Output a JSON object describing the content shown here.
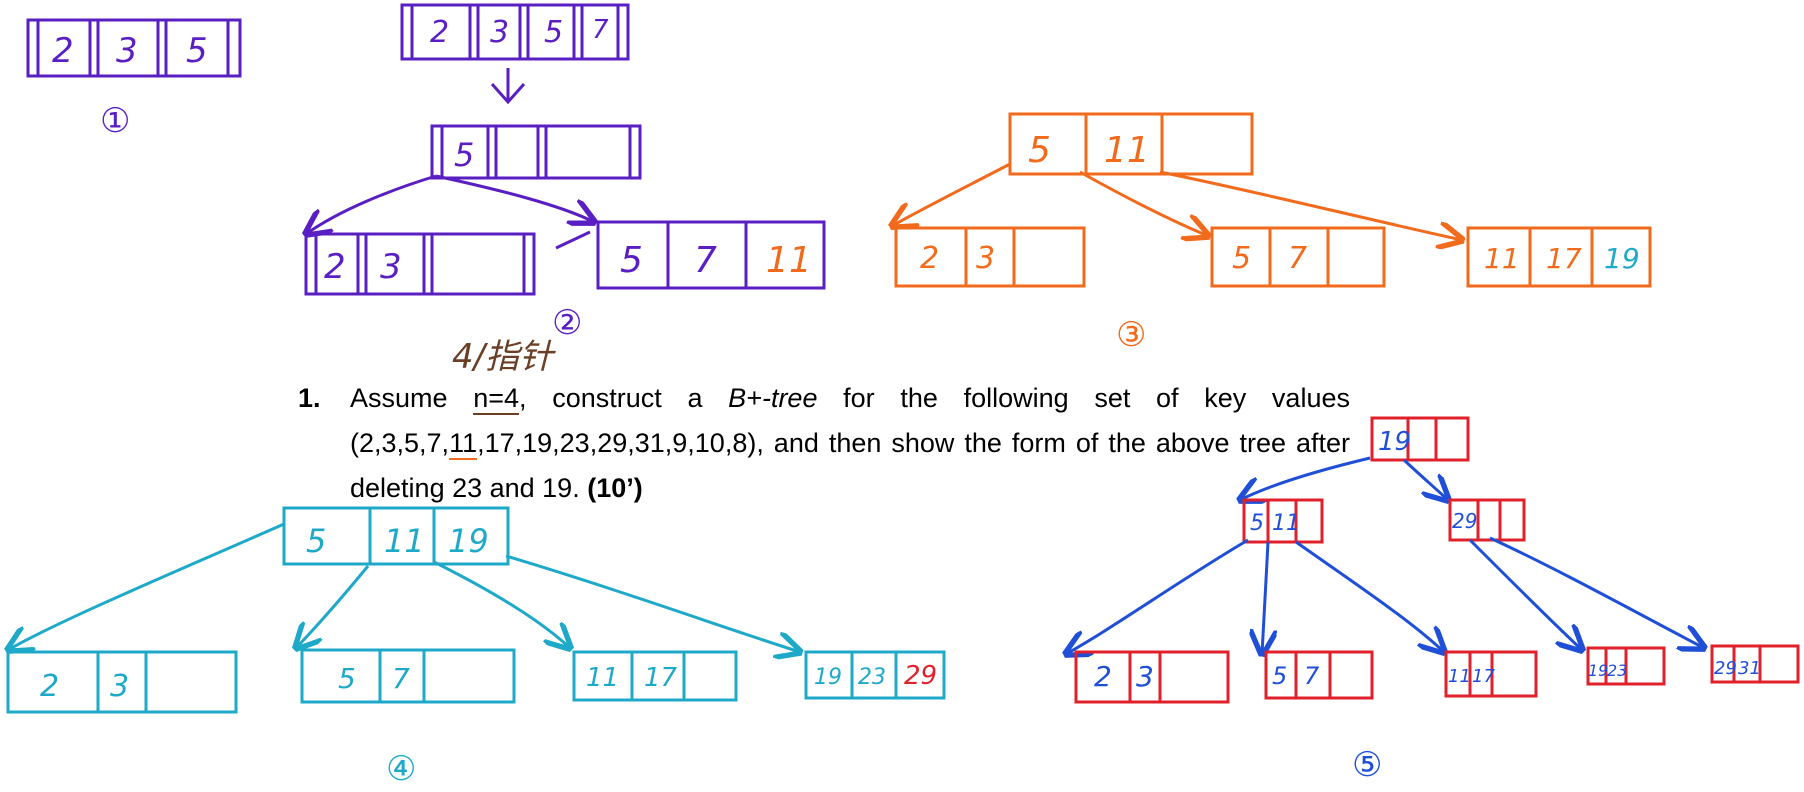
{
  "colors": {
    "purple": "#5a1fc2",
    "orange": "#f26a1b",
    "teal": "#1fa9c9",
    "red": "#e0202a",
    "blue": "#1f4fd6",
    "brown": "#6b3e26"
  },
  "question": {
    "number": "1.",
    "text_part1": "Assume ",
    "n_value": "n=4",
    "text_part2": ", construct a ",
    "tree_type": "B+-tree",
    "text_part3": " for the following set of key values (2,3,5,7,",
    "key_11": "11",
    "text_part4": ",17,19,23,29,31,9,10,8), and then show the form of the above tree after deleting 23 and 19. ",
    "points": "(10’)"
  },
  "annotation": {
    "note": "4/指针"
  },
  "step_labels": [
    "①",
    "②",
    "③",
    "④",
    "⑤"
  ],
  "steps": {
    "s1": {
      "node": [
        "2",
        "3",
        "5"
      ]
    },
    "s2": {
      "top": [
        "2",
        "3",
        "5",
        "7"
      ],
      "root": [
        "5",
        "",
        ""
      ],
      "left": [
        "2",
        "3",
        "",
        ""
      ],
      "right": [
        "5",
        "7",
        "11"
      ]
    },
    "s3": {
      "root": [
        "5",
        "11",
        ""
      ],
      "leaf1": [
        "2",
        "3",
        ""
      ],
      "leaf2": [
        "5",
        "7",
        ""
      ],
      "leaf3": [
        "11",
        "17",
        "19"
      ]
    },
    "s4": {
      "root": [
        "5",
        "11",
        "19"
      ],
      "leaf1": [
        "2",
        "3",
        ""
      ],
      "leaf2": [
        "5",
        "7",
        ""
      ],
      "leaf3": [
        "11",
        "17",
        ""
      ],
      "leaf4": [
        "19",
        "23",
        "29"
      ]
    },
    "s5": {
      "root": [
        "19",
        "",
        ""
      ],
      "int1": [
        "5",
        "11"
      ],
      "int2": [
        "29",
        ""
      ],
      "leaf1": [
        "2",
        "3",
        ""
      ],
      "leaf2": [
        "5",
        "7",
        ""
      ],
      "leaf3": [
        "11",
        "17",
        ""
      ],
      "leaf4": [
        "19",
        "23",
        ""
      ],
      "leaf5": [
        "29",
        "31",
        ""
      ]
    }
  }
}
